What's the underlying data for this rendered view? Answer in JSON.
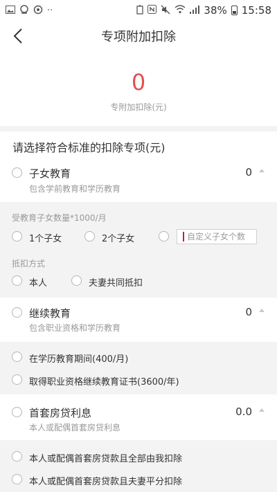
{
  "status_bar": {
    "battery": "38%",
    "time": "15:58",
    "icons_left": [
      "image-icon",
      "notify-icon",
      "sync-icon",
      "more-icon"
    ],
    "icons_right": [
      "battery-saver-icon",
      "nfc-icon",
      "mute-icon",
      "wifi-icon",
      "signal-icon",
      "battery-icon"
    ]
  },
  "nav": {
    "title": "专项附加扣除"
  },
  "summary": {
    "value": "0",
    "label": "专附加扣除(元)"
  },
  "section_title": "请选择符合标准的扣除专项(元)",
  "items": {
    "children": {
      "title": "子女教育",
      "subtitle": "包含学前教育和学历教育",
      "value": "0"
    },
    "continuing": {
      "title": "继续教育",
      "subtitle": "包含职业资格和学历教育",
      "value": "0"
    },
    "housing": {
      "title": "首套房贷利息",
      "subtitle": "本人或配偶首套房贷利息",
      "value": "0.0"
    }
  },
  "children_panel": {
    "count_label": "受教育子女数量*1000/月",
    "opt_one": "1个子女",
    "opt_two": "2个子女",
    "custom_placeholder": "自定义子女个数",
    "method_label": "抵扣方式",
    "opt_self": "本人",
    "opt_joint": "夫妻共同抵扣"
  },
  "continuing_panel": {
    "opt_degree": "在学历教育期间(400/月)",
    "opt_cert": "取得职业资格继续教育证书(3600/年)"
  },
  "housing_panel": {
    "opt_full": "本人或配偶首套房贷款且全部由我扣除",
    "opt_half": "本人或配偶首套房贷款且夫妻平分扣除"
  },
  "colors": {
    "accent": "#e0534f",
    "panel_bg": "#f3f3f3",
    "muted": "#999999"
  }
}
